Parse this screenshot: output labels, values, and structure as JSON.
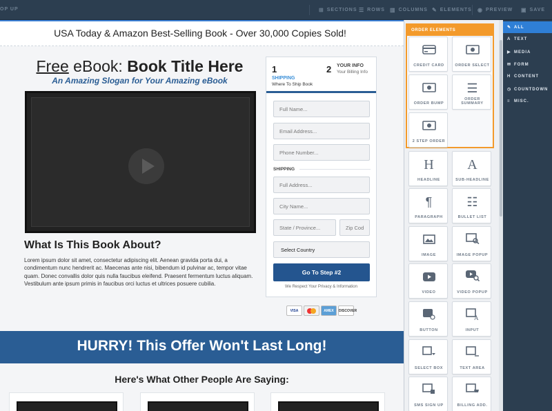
{
  "toolbar": {
    "left_label": "OP UP",
    "items": [
      {
        "icon": "sections-icon",
        "label": "SECTIONS"
      },
      {
        "icon": "rows-icon",
        "label": "ROWS"
      },
      {
        "icon": "columns-icon",
        "label": "COLUMNS"
      },
      {
        "icon": "elements-icon",
        "label": "ELEMENTS"
      },
      {
        "icon": "eye-icon",
        "label": "PREVIEW"
      },
      {
        "icon": "save-icon",
        "label": "SAVE"
      }
    ]
  },
  "page": {
    "banner": "USA Today & Amazon Best-Selling Book - Over 30,000 Copies Sold!",
    "title_free": "Free",
    "title_middle": " eBook: ",
    "title_bold": "Book Title Here",
    "slogan": "An Amazing Slogan for Your Amazing eBook",
    "about_title": "What Is This Book About?",
    "about_text": "Lorem ipsum dolor sit amet, consectetur adipiscing elit. Aenean gravida porta dui, a condimentum nunc hendrerit ac. Maecenas ante nisi, bibendum id pulvinar ac, tempor vitae quam. Donec convallis dolor quis nulla faucibus eleifend. Praesent fermentum luctus aliquam. Vestibulum ante ipsum primis in faucibus orci luctus et ultrices posuere cubilia.",
    "hurry": "HURRY! This Offer Won't Last Long!",
    "others": "Here's What Other People Are Saying:"
  },
  "form": {
    "step1": {
      "num": "1",
      "title": "SHIPPING",
      "sub": "Where To Ship Book"
    },
    "step2": {
      "num": "2",
      "title": "YOUR INFO",
      "sub": "Your Billing Info"
    },
    "full_name": "Full Name...",
    "email": "Email Address...",
    "phone": "Phone Number...",
    "shipping_label": "SHIPPING",
    "address": "Full Address...",
    "city": "City Name...",
    "state": "State / Province...",
    "zip": "Zip Cod",
    "country": "Select Country",
    "button": "Go To Step #2",
    "privacy": "We Respect Your Privacy & Information"
  },
  "cards": {
    "visa": "VISA",
    "amex": "AMEX",
    "discover": "DISCOVER"
  },
  "panel": {
    "order_header": "ORDER ELEMENTS",
    "order_tiles": [
      {
        "label": "CREDIT CARD",
        "icon": "credit-card-icon"
      },
      {
        "label": "ORDER SELECT",
        "icon": "money-icon"
      },
      {
        "label": "ORDER BUMP",
        "icon": "money-icon"
      },
      {
        "label": "ORDER SUMMARY",
        "icon": "list-icon"
      },
      {
        "label": "2 STEP ORDER",
        "icon": "money-icon"
      }
    ],
    "tiles": [
      {
        "label": "HEADLINE",
        "icon": "headline-icon"
      },
      {
        "label": "SUB-HEADLINE",
        "icon": "subheadline-icon"
      },
      {
        "label": "PARAGRAPH",
        "icon": "paragraph-icon"
      },
      {
        "label": "BULLET LIST",
        "icon": "bullet-list-icon"
      },
      {
        "label": "IMAGE",
        "icon": "image-icon"
      },
      {
        "label": "IMAGE POPUP",
        "icon": "image-popup-icon"
      },
      {
        "label": "VIDEO",
        "icon": "video-icon"
      },
      {
        "label": "VIDEO POPUP",
        "icon": "video-popup-icon"
      },
      {
        "label": "BUTTON",
        "icon": "button-icon"
      },
      {
        "label": "INPUT",
        "icon": "input-icon"
      },
      {
        "label": "SELECT BOX",
        "icon": "select-box-icon"
      },
      {
        "label": "TEXT AREA",
        "icon": "text-area-icon"
      },
      {
        "label": "SMS SIGN UP",
        "icon": "sms-icon"
      },
      {
        "label": "BILLING ADD.",
        "icon": "billing-icon"
      }
    ]
  },
  "categories": [
    {
      "label": "ALL",
      "icon": "all-icon",
      "active": true
    },
    {
      "label": "TEXT",
      "icon": "text-icon"
    },
    {
      "label": "MEDIA",
      "icon": "media-icon"
    },
    {
      "label": "FORM",
      "icon": "form-icon"
    },
    {
      "label": "CONTENT",
      "icon": "content-icon"
    },
    {
      "label": "COUNTDOWN",
      "icon": "countdown-icon"
    },
    {
      "label": "MISC.",
      "icon": "misc-icon"
    }
  ],
  "colors": {
    "accent": "#2f7fd6",
    "order_border": "#f39a2b",
    "brand_blue": "#2a5d94",
    "toolbar": "#2c3e50"
  }
}
